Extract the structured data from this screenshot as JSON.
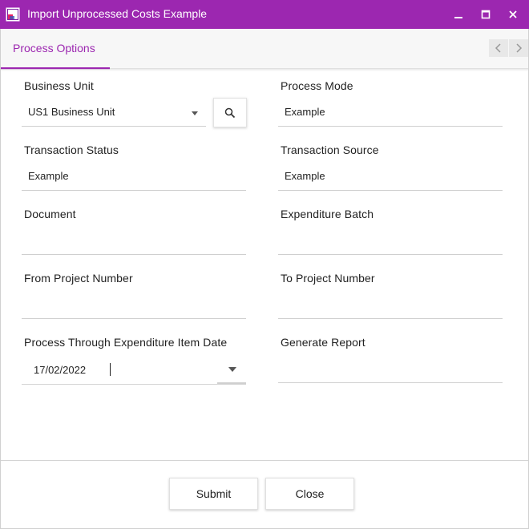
{
  "window": {
    "title": "Import Unprocessed Costs Example",
    "titlebar_color": "#9c27b0",
    "controls": {
      "minimize_icon": "minimize-icon",
      "maximize_icon": "maximize-icon",
      "close_icon": "close-icon"
    }
  },
  "tabs": [
    {
      "label": "Process Options",
      "active": true
    }
  ],
  "accent_color": "#9c27b0",
  "form": {
    "business_unit": {
      "label": "Business Unit",
      "value": "US1 Business Unit"
    },
    "process_mode": {
      "label": "Process Mode",
      "value": "Example"
    },
    "transaction_status": {
      "label": "Transaction Status",
      "value": "Example"
    },
    "transaction_source": {
      "label": "Transaction Source",
      "value": "Example"
    },
    "document": {
      "label": "Document",
      "value": ""
    },
    "expenditure_batch": {
      "label": "Expenditure Batch",
      "value": ""
    },
    "from_project_number": {
      "label": "From Project Number",
      "value": ""
    },
    "to_project_number": {
      "label": "To Project Number",
      "value": ""
    },
    "process_through_date": {
      "label": "Process Through Expenditure Item Date",
      "value": "17/02/2022"
    },
    "generate_report": {
      "label": "Generate Report",
      "value": ""
    }
  },
  "buttons": {
    "submit": "Submit",
    "close": "Close"
  }
}
